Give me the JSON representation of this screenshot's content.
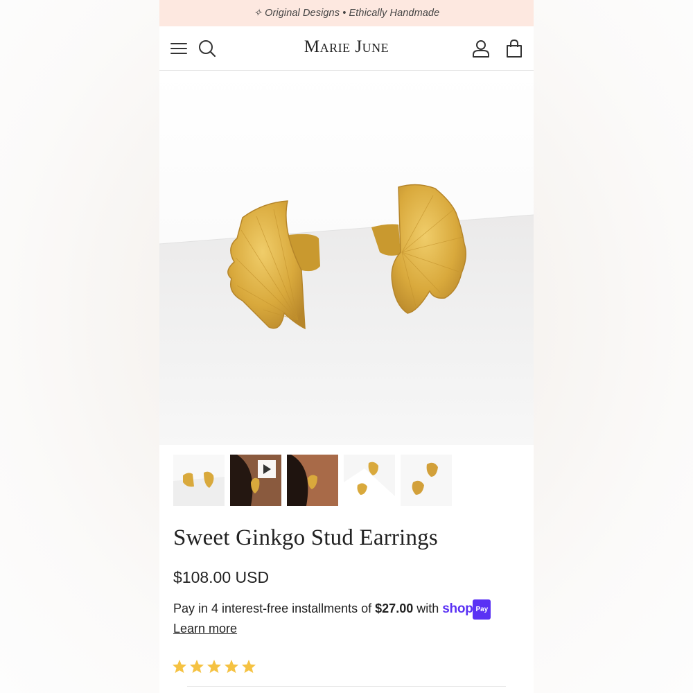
{
  "announcement": "✧ Original Designs • Ethically Handmade",
  "header": {
    "brand": "Marie June",
    "icons": [
      "menu-icon",
      "search-icon",
      "account-icon",
      "cart-icon"
    ]
  },
  "product": {
    "title": "Sweet Ginkgo Stud Earrings",
    "price": "$108.00 USD",
    "installments": {
      "prefix": "Pay in 4 interest-free installments of",
      "amount": "$27.00",
      "suffix": "with",
      "shop_logo": "shop",
      "pay_badge": "Pay",
      "learn_more": "Learn more"
    },
    "rating_stars": 5
  },
  "thumbnails": [
    {
      "name": "earrings-on-white",
      "video": false
    },
    {
      "name": "earring-worn-video",
      "video": true
    },
    {
      "name": "earring-worn",
      "video": false
    },
    {
      "name": "earrings-on-shelf",
      "video": false
    },
    {
      "name": "earrings-scattered",
      "video": false
    }
  ],
  "colors": {
    "announce_bg": "#fde8e0",
    "gold": "#d4a63c",
    "star": "#f5c242",
    "shop_purple": "#5a31f4"
  }
}
